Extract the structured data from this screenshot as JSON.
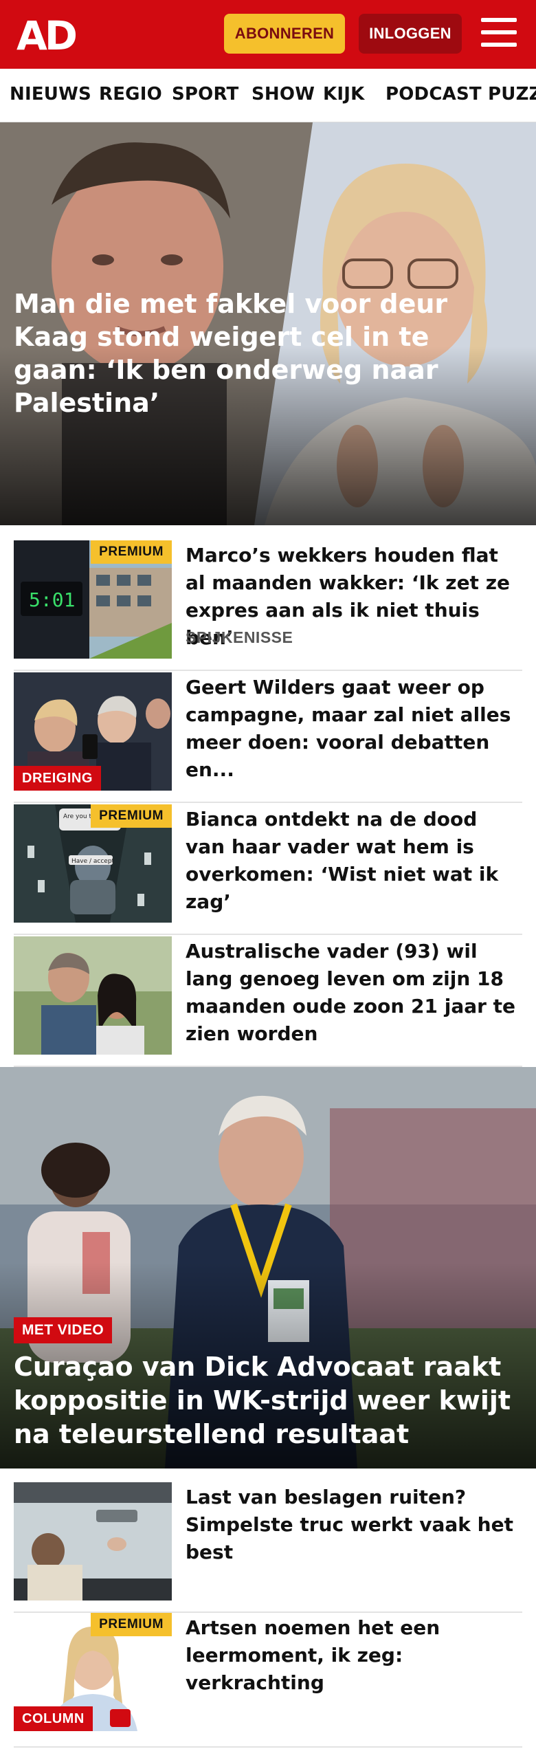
{
  "header": {
    "logo_text": "AD",
    "subscribe_label": "ABONNEREN",
    "login_label": "INLOGGEN",
    "menu_icon": "hamburger-menu-icon",
    "brand_color": "#d10a11",
    "accent_color": "#f5c02c"
  },
  "nav": {
    "items": [
      "NIEUWS",
      "REGIO",
      "SPORT",
      "SHOW",
      "KIJK",
      "PODCAST",
      "PUZZ"
    ]
  },
  "hero": {
    "title": "Man die met fakkel voor deur Kaag stond weigert cel in te gaan: ‘Ik ben onderweg naar Palestina’"
  },
  "articles": [
    {
      "title": "Marco’s wekkers houden flat al maanden wakker: ‘Ik zet ze expres aan als ik niet thuis ben’",
      "subtitle": "SPIJKENISSE",
      "badge": "PREMIUM",
      "thumb_text": "5:01"
    },
    {
      "title": "Geert Wilders gaat weer op campagne, maar zal niet alles meer doen: vooral debatten en...",
      "badge": "DREIGING"
    },
    {
      "title": "Bianca ontdekt na de dood van haar vader wat hem is overkomen: ‘Wist niet wat ik zag’",
      "badge": "PREMIUM",
      "thumb_text_top": "Are you there friend?",
      "thumb_text_bottom": "Have / accept"
    },
    {
      "title": "Australische vader (93) wil lang genoeg leven om zijn 18 maanden oude zoon 21 jaar te zien worden"
    }
  ],
  "hero2": {
    "badge": "MET VIDEO",
    "title": "Curaçao van Dick Advocaat raakt koppositie in WK-strijd weer kwijt na teleurstellend resultaat"
  },
  "articles2": [
    {
      "title": "Last van beslagen ruiten? Simpelste truc werkt vaak het best"
    },
    {
      "title": "Artsen noemen het een leermoment, ik zeg: verkrachting",
      "badge_top": "PREMIUM",
      "badge_bottom": "COLUMN",
      "comment_icon": "comment-bubble-icon"
    }
  ]
}
